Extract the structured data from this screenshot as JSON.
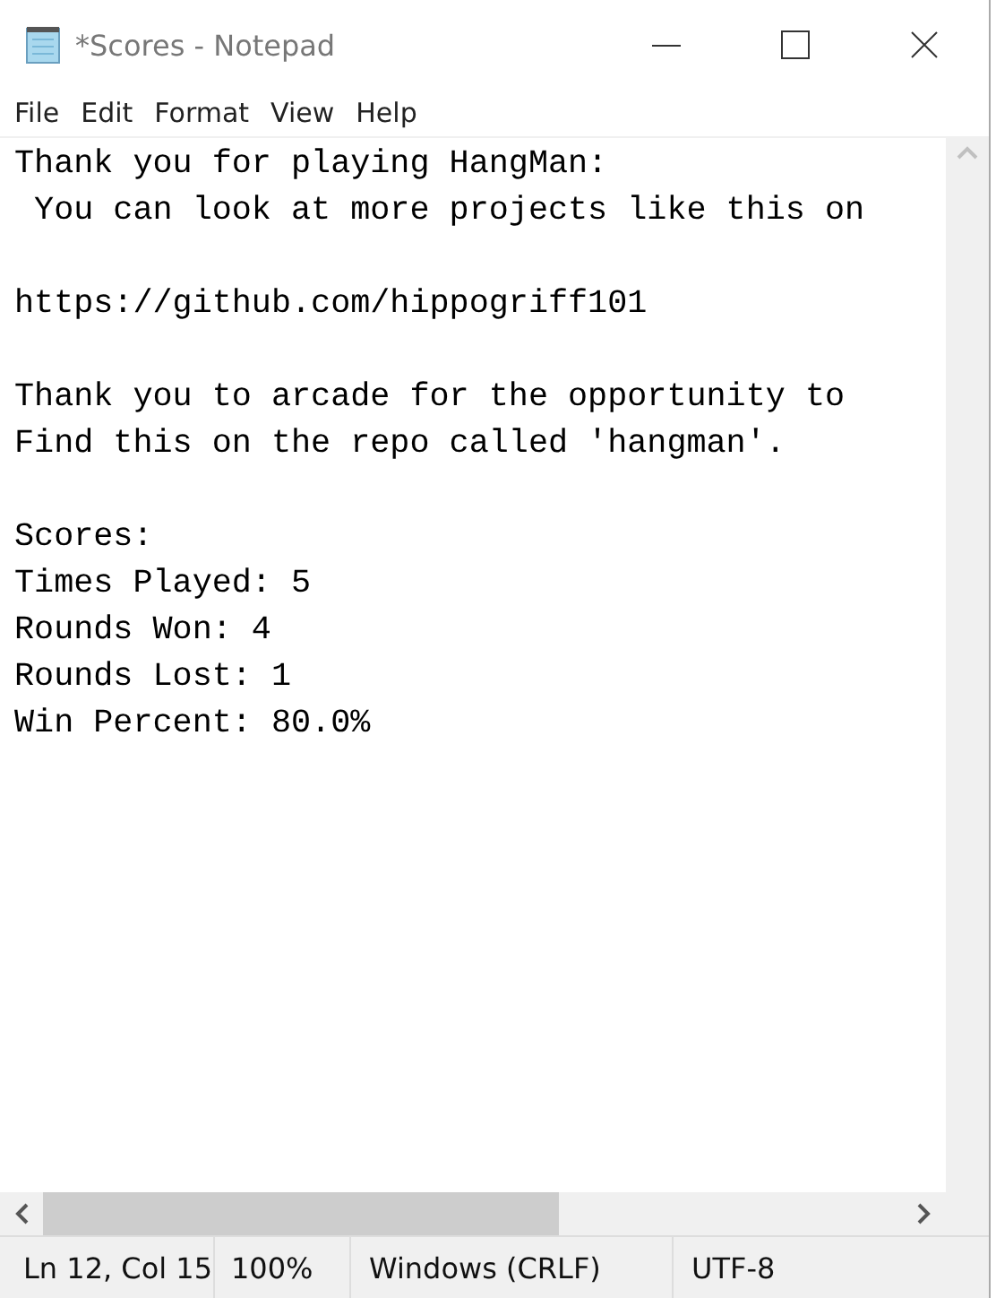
{
  "window": {
    "title": "*Scores - Notepad"
  },
  "menu": [
    "File",
    "Edit",
    "Format",
    "View",
    "Help"
  ],
  "editor": {
    "paragraphs": [
      [
        "Thank you for playing HangMan:",
        " You can look at more projects like this on"
      ],
      [
        "https://github.com/hippogriff101"
      ],
      [
        "Thank you to arcade for the opportunity to",
        "Find this on the repo called 'hangman'."
      ],
      [
        "Scores:",
        "Times Played: 5",
        "Rounds Won: 4",
        "Rounds Lost: 1",
        "Win Percent: 80.0%"
      ]
    ]
  },
  "status_bar": {
    "position": "Ln 12, Col 15",
    "zoom": "100%",
    "line_ending": "Windows (CRLF)",
    "encoding": "UTF-8"
  }
}
